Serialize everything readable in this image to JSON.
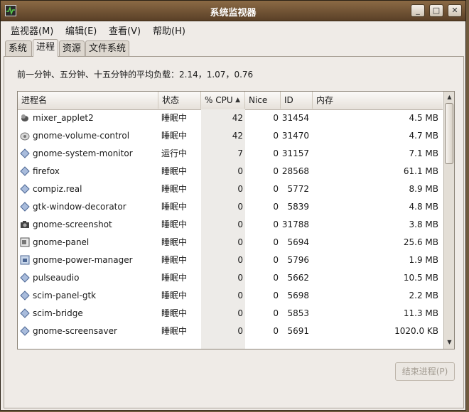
{
  "window": {
    "title": "系统监视器"
  },
  "titlebar_buttons": {
    "minimize": "_",
    "maximize": "□",
    "close": "✕"
  },
  "menubar": [
    {
      "label": "监视器(M)"
    },
    {
      "label": "编辑(E)"
    },
    {
      "label": "查看(V)"
    },
    {
      "label": "帮助(H)"
    }
  ],
  "tabs": [
    {
      "label": "系统",
      "active": false
    },
    {
      "label": "进程",
      "active": true
    },
    {
      "label": "资源",
      "active": false
    },
    {
      "label": "文件系统",
      "active": false
    }
  ],
  "load_average": "前一分钟、五分钟、十五分钟的平均负载：2.14，1.07，0.76",
  "columns": {
    "name": "进程名",
    "state": "状态",
    "cpu": "% CPU",
    "nice": "Nice",
    "id": "ID",
    "memory": "内存"
  },
  "sort": {
    "column": "cpu",
    "direction": "descending"
  },
  "processes": [
    {
      "name": "mixer_applet2",
      "state": "睡眠中",
      "cpu": "42",
      "nice": "0",
      "id": "31454",
      "memory": "4.5 MB",
      "icon": "mixer-icon"
    },
    {
      "name": "gnome-volume-control",
      "state": "睡眠中",
      "cpu": "42",
      "nice": "0",
      "id": "31470",
      "memory": "4.7 MB",
      "icon": "volume-icon"
    },
    {
      "name": "gnome-system-monitor",
      "state": "运行中",
      "cpu": "7",
      "nice": "0",
      "id": "31157",
      "memory": "7.1 MB",
      "icon": "diamond-icon"
    },
    {
      "name": "firefox",
      "state": "睡眠中",
      "cpu": "0",
      "nice": "0",
      "id": "28568",
      "memory": "61.1 MB",
      "icon": "diamond-icon"
    },
    {
      "name": "compiz.real",
      "state": "睡眠中",
      "cpu": "0",
      "nice": "0",
      "id": "5772",
      "memory": "8.9 MB",
      "icon": "diamond-icon"
    },
    {
      "name": "gtk-window-decorator",
      "state": "睡眠中",
      "cpu": "0",
      "nice": "0",
      "id": "5839",
      "memory": "4.8 MB",
      "icon": "diamond-icon"
    },
    {
      "name": "gnome-screenshot",
      "state": "睡眠中",
      "cpu": "0",
      "nice": "0",
      "id": "31788",
      "memory": "3.8 MB",
      "icon": "camera-icon"
    },
    {
      "name": "gnome-panel",
      "state": "睡眠中",
      "cpu": "0",
      "nice": "0",
      "id": "5694",
      "memory": "25.6 MB",
      "icon": "panel-icon"
    },
    {
      "name": "gnome-power-manager",
      "state": "睡眠中",
      "cpu": "0",
      "nice": "0",
      "id": "5796",
      "memory": "1.9 MB",
      "icon": "power-icon"
    },
    {
      "name": "pulseaudio",
      "state": "睡眠中",
      "cpu": "0",
      "nice": "0",
      "id": "5662",
      "memory": "10.5 MB",
      "icon": "diamond-icon"
    },
    {
      "name": "scim-panel-gtk",
      "state": "睡眠中",
      "cpu": "0",
      "nice": "0",
      "id": "5698",
      "memory": "2.2 MB",
      "icon": "diamond-icon"
    },
    {
      "name": "scim-bridge",
      "state": "睡眠中",
      "cpu": "0",
      "nice": "0",
      "id": "5853",
      "memory": "11.3 MB",
      "icon": "diamond-icon"
    },
    {
      "name": "gnome-screensaver",
      "state": "睡眠中",
      "cpu": "0",
      "nice": "0",
      "id": "5691",
      "memory": "1020.0 KB",
      "icon": "diamond-icon"
    }
  ],
  "end_process_button": "结束进程(P)"
}
